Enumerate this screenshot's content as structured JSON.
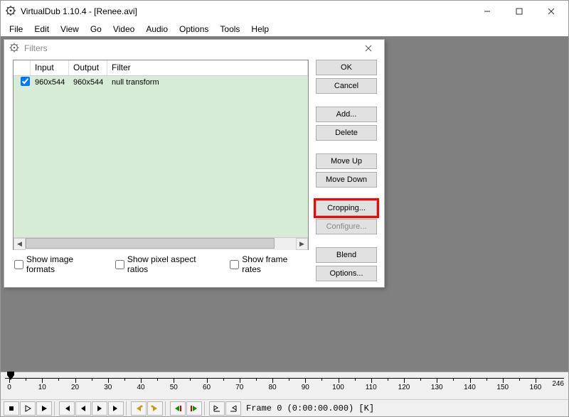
{
  "window": {
    "title": "VirtualDub 1.10.4 - [Renee.avi]"
  },
  "menu": [
    "File",
    "Edit",
    "View",
    "Go",
    "Video",
    "Audio",
    "Options",
    "Tools",
    "Help"
  ],
  "dialog": {
    "title": "Filters",
    "columns": {
      "input": "Input",
      "output": "Output",
      "filter": "Filter"
    },
    "rows": [
      {
        "checked": true,
        "input": "960x544",
        "output": "960x544",
        "filter": "null transform"
      }
    ],
    "checks": {
      "image_formats": "Show image formats",
      "pixel_ratios": "Show pixel aspect ratios",
      "frame_rates": "Show frame rates"
    },
    "buttons": {
      "ok": "OK",
      "cancel": "Cancel",
      "add": "Add...",
      "delete": "Delete",
      "move_up": "Move Up",
      "move_down": "Move Down",
      "cropping": "Cropping...",
      "configure": "Configure...",
      "blend": "Blend",
      "options": "Options..."
    }
  },
  "timeline": {
    "ticks": [
      0,
      10,
      20,
      30,
      40,
      50,
      60,
      70,
      80,
      90,
      100,
      110,
      120,
      130,
      140,
      150,
      160
    ],
    "end": "246"
  },
  "status": {
    "frame": "Frame 0 (0:00:00.000) [K]"
  }
}
